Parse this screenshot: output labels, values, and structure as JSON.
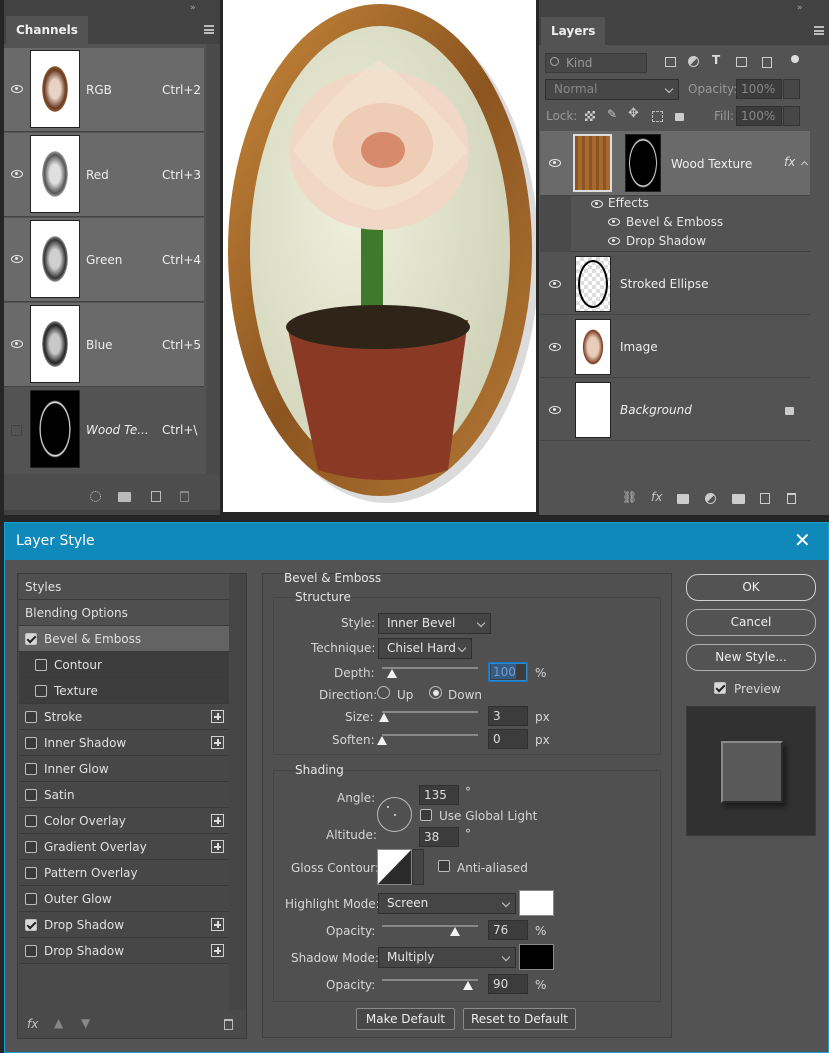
{
  "channels": {
    "title": "Channels",
    "rows": [
      {
        "name": "RGB",
        "shortcut": "Ctrl+2"
      },
      {
        "name": "Red",
        "shortcut": "Ctrl+3"
      },
      {
        "name": "Green",
        "shortcut": "Ctrl+4"
      },
      {
        "name": "Blue",
        "shortcut": "Ctrl+5"
      },
      {
        "name": "Wood Te...",
        "shortcut": "Ctrl+\\"
      }
    ]
  },
  "layers": {
    "title": "Layers",
    "filter_placeholder": "Kind",
    "blend_mode": "Normal",
    "opacity_label": "Opacity:",
    "opacity_value": "100%",
    "lock_label": "Lock:",
    "fill_label": "Fill:",
    "fill_value": "100%",
    "items": [
      {
        "name": "Wood Texture",
        "fx": "fx"
      },
      {
        "name": "Stroked Ellipse"
      },
      {
        "name": "Image"
      },
      {
        "name": "Background"
      }
    ],
    "effects_label": "Effects",
    "effects": [
      "Bevel & Emboss",
      "Drop Shadow"
    ]
  },
  "dialog": {
    "title": "Layer Style",
    "styles_header": "Styles",
    "blending_options": "Blending Options",
    "style_items": [
      {
        "label": "Bevel & Emboss",
        "checked": true
      },
      {
        "label": "Contour",
        "checked": false
      },
      {
        "label": "Texture",
        "checked": false
      },
      {
        "label": "Stroke",
        "checked": false
      },
      {
        "label": "Inner Shadow",
        "checked": false
      },
      {
        "label": "Inner Glow",
        "checked": false
      },
      {
        "label": "Satin",
        "checked": false
      },
      {
        "label": "Color Overlay",
        "checked": false
      },
      {
        "label": "Gradient Overlay",
        "checked": false
      },
      {
        "label": "Pattern Overlay",
        "checked": false
      },
      {
        "label": "Outer Glow",
        "checked": false
      },
      {
        "label": "Drop Shadow",
        "checked": true
      },
      {
        "label": "Drop Shadow",
        "checked": false
      }
    ],
    "section_title": "Bevel & Emboss",
    "structure_title": "Structure",
    "style_label": "Style:",
    "style_value": "Inner Bevel",
    "technique_label": "Technique:",
    "technique_value": "Chisel Hard",
    "depth_label": "Depth:",
    "depth_value": "100",
    "depth_unit": "%",
    "direction_label": "Direction:",
    "direction_up": "Up",
    "direction_down": "Down",
    "size_label": "Size:",
    "size_value": "3",
    "size_unit": "px",
    "soften_label": "Soften:",
    "soften_value": "0",
    "soften_unit": "px",
    "shading_title": "Shading",
    "angle_label": "Angle:",
    "angle_value": "135",
    "degree": "°",
    "global_light": "Use Global Light",
    "altitude_label": "Altitude:",
    "altitude_value": "38",
    "gloss_label": "Gloss Contour:",
    "antialiased": "Anti-aliased",
    "highlight_label": "Highlight Mode:",
    "highlight_value": "Screen",
    "highlight_color": "#ffffff",
    "opacity_label": "Opacity:",
    "highlight_opacity": "76",
    "shadow_label": "Shadow Mode:",
    "shadow_value": "Multiply",
    "shadow_color": "#000000",
    "shadow_opacity": "90",
    "pct": "%",
    "make_default": "Make Default",
    "reset_default": "Reset to Default",
    "ok": "OK",
    "cancel": "Cancel",
    "new_style": "New Style...",
    "preview": "Preview"
  }
}
